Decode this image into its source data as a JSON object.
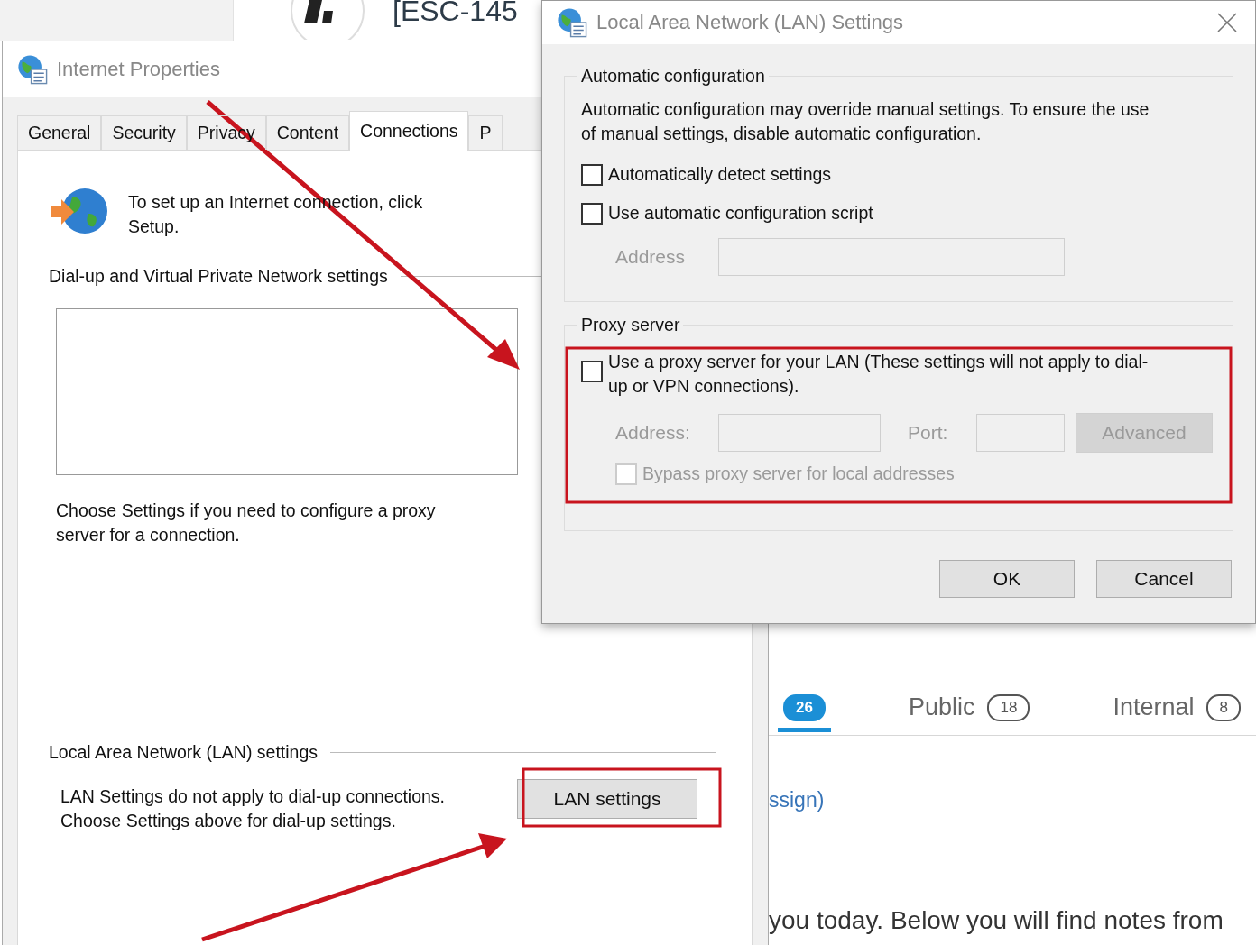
{
  "background_page": {
    "heading": "[ESC-145",
    "tabs": [
      {
        "count": "26",
        "selected": true
      },
      {
        "label": "Public",
        "count": "18",
        "selected": false
      },
      {
        "label": "Internal",
        "count": "8",
        "selected": false
      }
    ],
    "link_fragment": "ssign)",
    "body_fragment": "you today. Below you will find notes from"
  },
  "internet_properties": {
    "title": "Internet Properties",
    "tabs": [
      {
        "label": "General",
        "selected": false
      },
      {
        "label": "Security",
        "selected": false
      },
      {
        "label": "Privacy",
        "selected": false
      },
      {
        "label": "Content",
        "selected": false
      },
      {
        "label": "Connections",
        "selected": true
      },
      {
        "label": "P",
        "selected": false
      }
    ],
    "setup_text": "To set up an Internet connection, click Setup.",
    "dialup_group": "Dial-up and Virtual Private Network settings",
    "proxy_hint": "Choose Settings if you need to configure a proxy server for a connection.",
    "lan_group": "Local Area Network (LAN) settings",
    "lan_note": "LAN Settings do not apply to dial-up connections. Choose Settings above for dial-up settings.",
    "lan_button": "LAN settings"
  },
  "lan_dialog": {
    "title": "Local Area Network (LAN) Settings",
    "automatic": {
      "legend": "Automatic configuration",
      "note": "Automatic configuration may override manual settings.  To ensure the use of manual settings, disable automatic configuration.",
      "options": [
        {
          "label": "Automatically detect settings",
          "checked": false
        },
        {
          "label": "Use automatic configuration script",
          "checked": false
        }
      ],
      "address_label": "Address",
      "address_disabled": true
    },
    "proxy": {
      "legend": "Proxy server",
      "use_proxy": {
        "label": "Use a proxy server for your LAN (These settings will not apply to dial-up or VPN connections).",
        "checked": false
      },
      "disabled": true,
      "address_label": "Address:",
      "port_label": "Port:",
      "advanced": "Advanced",
      "bypass": {
        "label": "Bypass proxy server for local addresses",
        "checked": false
      }
    },
    "buttons": [
      "OK",
      "Cancel"
    ]
  }
}
